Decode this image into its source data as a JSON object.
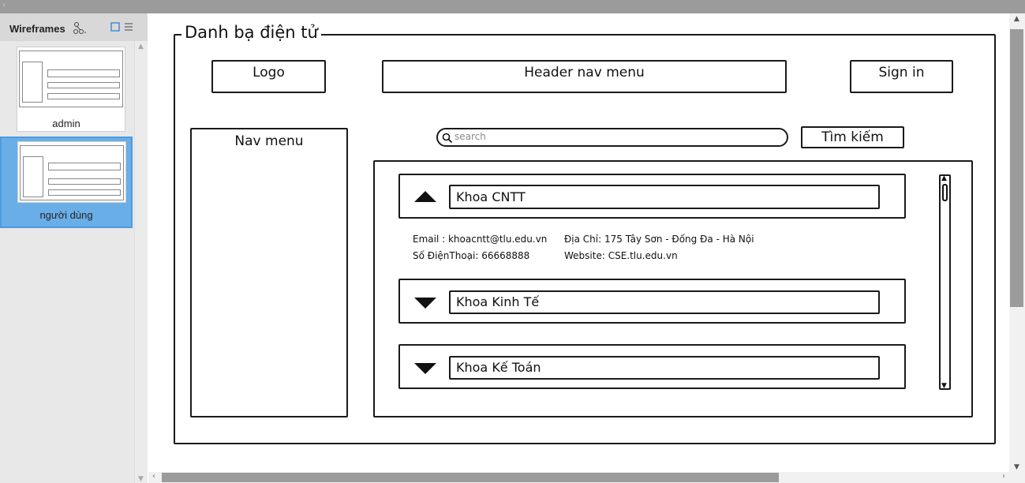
{
  "panel": {
    "title": "Wireframes",
    "items": [
      {
        "label": "admin"
      },
      {
        "label": "người dùng"
      }
    ]
  },
  "wireframe": {
    "title": "Danh bạ điện tử",
    "logo": "Logo",
    "header_nav": "Header nav menu",
    "sign_in": "Sign in",
    "nav_menu": "Nav menu",
    "search_placeholder": "search",
    "search_button": "Tìm kiếm",
    "departments": [
      {
        "name": "Khoa CNTT",
        "expanded": true,
        "email": "Email : khoacntt@tlu.edu.vn",
        "phone": "Số ĐiệnThoại: 66668888",
        "address": "Địa Chỉ: 175 Tây Sơn - Đống Đa - Hà Nội",
        "website": "Website: CSE.tlu.edu.vn"
      },
      {
        "name": "Khoa Kinh Tế",
        "expanded": false
      },
      {
        "name": "Khoa Kế Toán",
        "expanded": false
      }
    ]
  },
  "colors": {
    "selected_item": "#6aaee8",
    "sketch_stroke": "#1a1a1a"
  }
}
